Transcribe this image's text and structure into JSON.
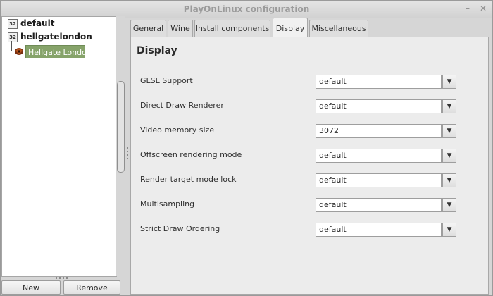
{
  "window": {
    "title": "PlayOnLinux configuration"
  },
  "titlebar_buttons": {
    "minimize": "–",
    "close": "✕"
  },
  "tree": {
    "prefixes": [
      {
        "label": "default",
        "icon": "32-bit-badge-icon"
      },
      {
        "label": "hellgatelondon",
        "icon": "32-bit-badge-icon"
      }
    ],
    "badge_text": "32",
    "selected_game": {
      "label": "Hellgate London",
      "icon": "game-icon"
    }
  },
  "bottom_buttons": {
    "new_label": "New",
    "remove_label": "Remove"
  },
  "tabs": [
    {
      "label": "General"
    },
    {
      "label": "Wine"
    },
    {
      "label": "Install components"
    },
    {
      "label": "Display",
      "active": true
    },
    {
      "label": "Miscellaneous"
    }
  ],
  "panel": {
    "title": "Display",
    "settings": [
      {
        "label": "GLSL Support",
        "value": "default"
      },
      {
        "label": "Direct Draw Renderer",
        "value": "default"
      },
      {
        "label": "Video memory size",
        "value": "3072"
      },
      {
        "label": "Offscreen rendering mode",
        "value": "default"
      },
      {
        "label": "Render target mode lock",
        "value": "default"
      },
      {
        "label": "Multisampling",
        "value": "default"
      },
      {
        "label": "Strict Draw Ordering",
        "value": "default"
      }
    ],
    "dropdown_glyph": "▼"
  }
}
